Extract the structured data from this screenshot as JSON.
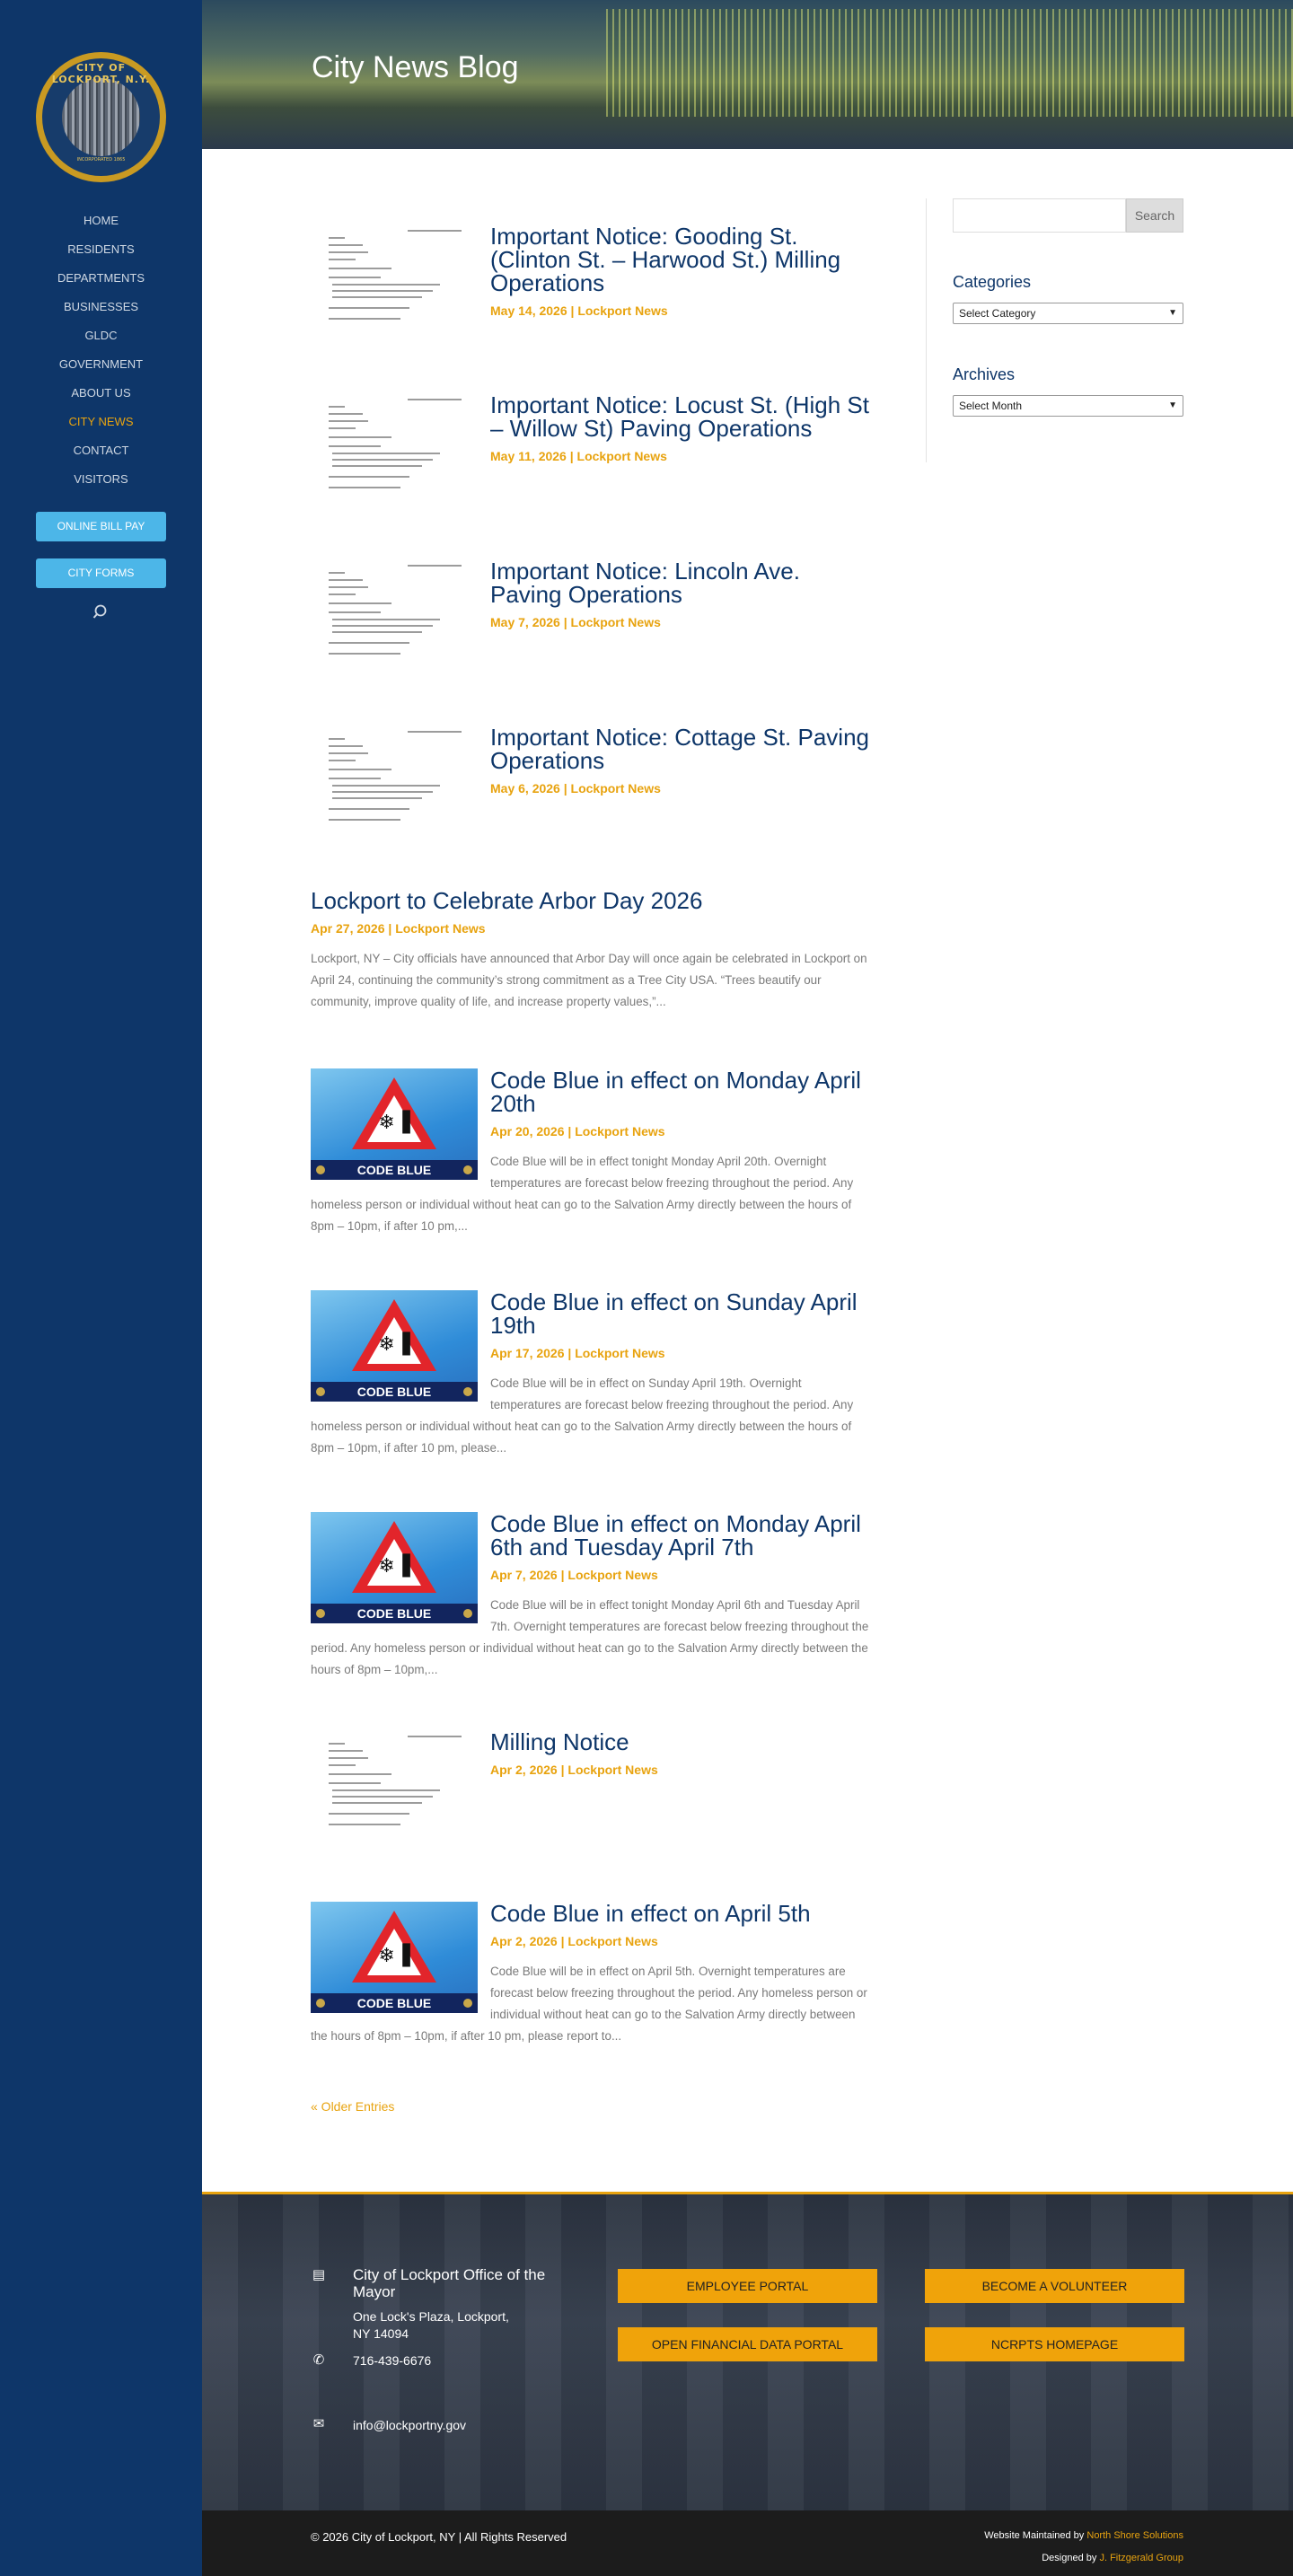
{
  "brand": {
    "logo_text": "CITY OF LOCKPORT, N.Y.",
    "logo_sub": "INCORPORATED 1865",
    "accent": "#e8a30f",
    "sidebar_bg": "#0e3669",
    "button_bg": "#4cb6e8"
  },
  "nav": {
    "items": [
      "HOME",
      "RESIDENTS",
      "DEPARTMENTS",
      "BUSINESSES",
      "GLDC",
      "GOVERNMENT",
      "ABOUT US",
      "CITY NEWS",
      "CONTACT",
      "VISITORS"
    ],
    "active": "CITY NEWS",
    "bill_pay": "ONLINE BILL PAY",
    "city_forms": "CITY FORMS",
    "search_icon": "search-icon"
  },
  "hero": {
    "title": "City News Blog"
  },
  "posts": [
    {
      "title": "Important Notice: Gooding St. (Clinton St. – Harwood St.) Milling Operations",
      "meta": "May 14, 2026 | Lockport News",
      "thumb": "document"
    },
    {
      "title": "Important Notice: Locust St. (High St – Willow St) Paving Operations",
      "meta": "May 11, 2026 | Lockport News",
      "thumb": "document"
    },
    {
      "title": "Important Notice: Lincoln Ave. Paving Operations",
      "meta": "May 7, 2026 | Lockport News",
      "thumb": "document"
    },
    {
      "title": "Important Notice: Cottage St. Paving Operations",
      "meta": "May 6, 2026 | Lockport News",
      "thumb": "document"
    },
    {
      "title": "Lockport to Celebrate Arbor Day 2026",
      "meta": "Apr 27, 2026 | Lockport News",
      "thumb": "none",
      "excerpt": "Lockport, NY – City officials have announced that Arbor Day will once again be celebrated in Lockport on April 24, continuing the community’s strong commitment as a Tree City USA. “Trees beautify our community, improve quality of life, and increase property values,”..."
    },
    {
      "title": "Code Blue in effect on Monday April 20th",
      "meta": "Apr 20, 2026 | Lockport News",
      "thumb": "codeblue",
      "excerpt": "Code Blue will be in effect tonight Monday April 20th. Overnight temperatures are forecast below freezing throughout the period. Any homeless person or individual without heat can go to the Salvation Army directly between the hours of 8pm – 10pm, if after 10 pm,..."
    },
    {
      "title": "Code Blue in effect on Sunday April 19th",
      "meta": "Apr 17, 2026 | Lockport News",
      "thumb": "codeblue",
      "excerpt": "Code Blue will be in effect on Sunday April 19th. Overnight temperatures are forecast below freezing throughout the period. Any homeless person or individual without heat can go to the Salvation Army directly between the hours of 8pm – 10pm, if after 10 pm, please..."
    },
    {
      "title": "Code Blue in effect on Monday April 6th and Tuesday April 7th",
      "meta": "Apr 7, 2026 | Lockport News",
      "thumb": "codeblue",
      "excerpt": "Code Blue will be in effect tonight Monday April 6th and Tuesday April 7th. Overnight temperatures are forecast below freezing throughout the period. Any homeless person or individual without heat can go to the Salvation Army directly between the hours of 8pm – 10pm,..."
    },
    {
      "title": "Milling Notice",
      "meta": "Apr 2, 2026 | Lockport News",
      "thumb": "document"
    },
    {
      "title": "Code Blue in effect on April 5th",
      "meta": "Apr 2, 2026 | Lockport News",
      "thumb": "codeblue",
      "excerpt": "Code Blue will be in effect on April 5th. Overnight temperatures are forecast below freezing throughout the period. Any homeless person or individual without heat can go to the Salvation Army directly between the hours of 8pm – 10pm, if after 10 pm, please report to..."
    }
  ],
  "codeblue_label": "CODE BLUE",
  "older_entries": "« Older Entries",
  "widgets": {
    "search_button": "Search",
    "categories_title": "Categories",
    "categories_select": "Select Category",
    "archives_title": "Archives",
    "archives_select": "Select Month"
  },
  "footer": {
    "office": "City of Lockport Office of the Mayor",
    "address_line1": "One Lock's Plaza, Lockport,",
    "address_line2": "NY 14094",
    "phone": "716-439-6676",
    "email": "info@lockportny.gov",
    "buttons": [
      "EMPLOYEE PORTAL",
      "BECOME A VOLUNTEER",
      "OPEN FINANCIAL DATA PORTAL",
      "NCRPTS HOMEPAGE"
    ],
    "copyright": "© 2026 City of Lockport, NY | All Rights Reserved",
    "maintained_prefix": "Website Maintained by",
    "maintained_by": "North Shore Solutions",
    "designed_prefix": "Designed by",
    "designed_by": "J. Fitzgerald Group"
  }
}
